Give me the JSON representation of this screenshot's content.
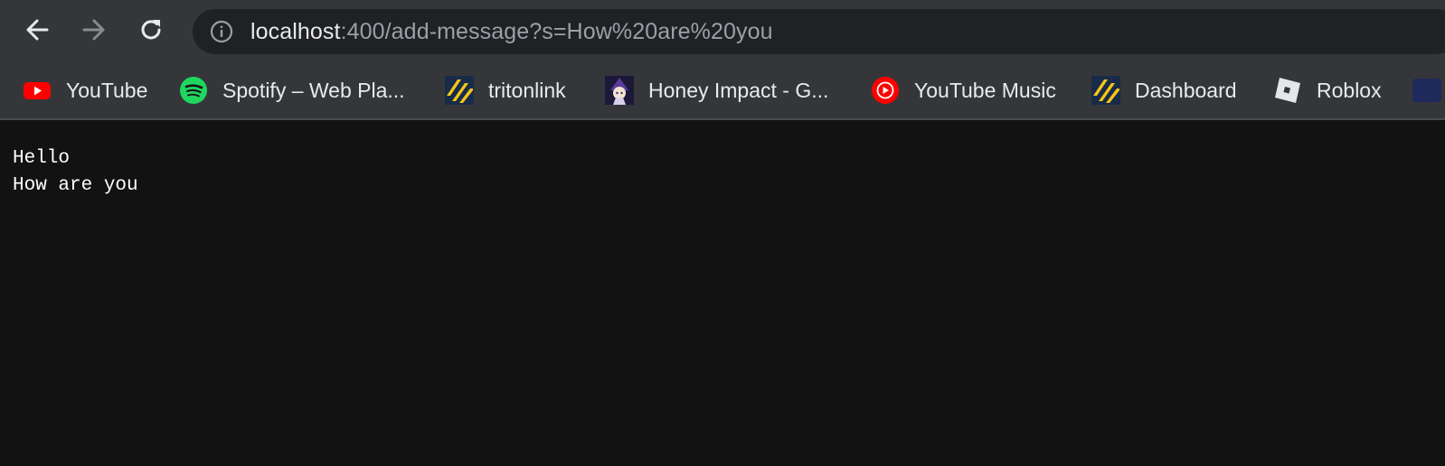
{
  "browser": {
    "url_host": "localhost",
    "url_rest": ":400/add-message?s=How%20are%20you",
    "nav": {
      "back_icon": "arrow-left-icon",
      "forward_icon": "arrow-right-icon",
      "reload_icon": "reload-icon",
      "site_info_icon": "info-icon"
    }
  },
  "bookmarks": [
    {
      "label": "YouTube",
      "icon": "youtube-icon"
    },
    {
      "label": "Spotify – Web Pla...",
      "icon": "spotify-icon"
    },
    {
      "label": "tritonlink",
      "icon": "tritonlink-icon"
    },
    {
      "label": "Honey Impact - G...",
      "icon": "honey-impact-icon"
    },
    {
      "label": "YouTube Music",
      "icon": "youtube-music-icon"
    },
    {
      "label": "Dashboard",
      "icon": "dashboard-icon"
    },
    {
      "label": "Roblox",
      "icon": "roblox-icon"
    }
  ],
  "page": {
    "lines": [
      "Hello",
      "How are you"
    ]
  },
  "colors": {
    "toolbar_bg": "#35363a",
    "omnibox_bg": "#202124",
    "page_bg": "#121212",
    "page_text": "#ffffff"
  }
}
